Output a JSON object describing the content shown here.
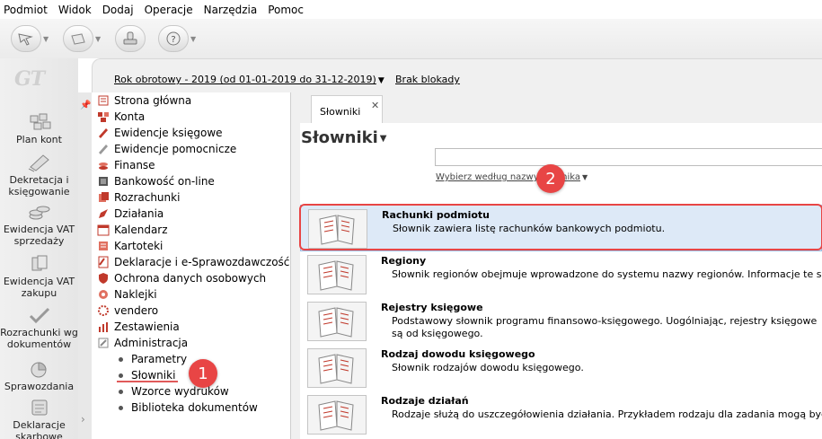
{
  "menu": [
    "Podmiot",
    "Widok",
    "Dodaj",
    "Operacje",
    "Narzędzia",
    "Pomoc"
  ],
  "logo": "GT",
  "left_panel": {
    "items": [
      {
        "label": "Plan kont",
        "icon": "plan-kont-icon"
      },
      {
        "label": "Dekretacja i księgowanie",
        "icon": "dekretacja-icon"
      },
      {
        "label": "Ewidencja VAT sprzedaży",
        "icon": "vat-sprzedazy-icon"
      },
      {
        "label": "Ewidencja VAT zakupu",
        "icon": "vat-zakupu-icon"
      },
      {
        "label": "Rozrachunki wg dokumentów",
        "icon": "rozrachunki-icon"
      },
      {
        "label": "Sprawozdania",
        "icon": "sprawozdania-icon"
      },
      {
        "label": "Deklaracje skarbowe",
        "icon": "deklaracje-icon"
      }
    ]
  },
  "pathbar": {
    "rok": "Rok obrotowy - 2019  (od 01-01-2019 do 31-12-2019)",
    "blokada": "Brak blokady"
  },
  "tree": {
    "items": [
      {
        "label": "Strona główna",
        "icon": "home-icon",
        "color": "#c0392b"
      },
      {
        "label": "Konta",
        "icon": "accounts-icon",
        "color": "#c0392b"
      },
      {
        "label": "Ewidencje księgowe",
        "icon": "ledger-icon",
        "color": "#c0392b"
      },
      {
        "label": "Ewidencje pomocnicze",
        "icon": "aux-ledger-icon",
        "color": "#888888"
      },
      {
        "label": "Finanse",
        "icon": "finance-icon",
        "color": "#c0392b"
      },
      {
        "label": "Bankowość on-line",
        "icon": "bank-icon",
        "color": "#555555"
      },
      {
        "label": "Rozrachunki",
        "icon": "settlements-icon",
        "color": "#c0392b"
      },
      {
        "label": "Działania",
        "icon": "actions-icon",
        "color": "#c0392b"
      },
      {
        "label": "Kalendarz",
        "icon": "calendar-icon",
        "color": "#c0392b"
      },
      {
        "label": "Kartoteki",
        "icon": "files-icon",
        "color": "#c0392b"
      },
      {
        "label": "Deklaracje i e-Sprawozdawczość",
        "icon": "declarations-icon",
        "color": "#c0392b"
      },
      {
        "label": "Ochrona danych osobowych",
        "icon": "shield-icon",
        "color": "#c0392b"
      },
      {
        "label": "Naklejki",
        "icon": "stickers-icon",
        "color": "#c0392b"
      },
      {
        "label": "vendero",
        "icon": "vendero-icon",
        "color": "#c0392b"
      },
      {
        "label": "Zestawienia",
        "icon": "reports-icon",
        "color": "#c0392b"
      },
      {
        "label": "Administracja",
        "icon": "admin-icon",
        "color": "#888888"
      }
    ],
    "sub_items": [
      "Parametry",
      "Słowniki",
      "Wzorce wydruków",
      "Biblioteka dokumentów"
    ]
  },
  "tab": {
    "label": "Słowniki",
    "close": "✕"
  },
  "content": {
    "heading": "Słowniki",
    "search_mode": "Wybierz według nazwy słownika",
    "dictionaries": [
      {
        "title": "Rachunki podmiotu",
        "desc": "Słownik zawiera listę rachunków bankowych podmiotu."
      },
      {
        "title": "Regiony",
        "desc": "Słownik regionów obejmuje wprowadzone do systemu nazwy regionów. Informacje te są wyk"
      },
      {
        "title": "Rejestry księgowe",
        "desc": "Podstawowy słownik programu finansowo-księgowego. Uogólniając, rejestry księgowe są od księgowego."
      },
      {
        "title": "Rodzaj dowodu księgowego",
        "desc": "Słownik rodzajów dowodu księgowego."
      },
      {
        "title": "Rodzaje działań",
        "desc": "Rodzaje służą do uszczegółowienia działania. Przykładem rodzaju dla zadania mogą być: \"Zad"
      }
    ]
  },
  "badges": [
    "1",
    "2"
  ],
  "colors": {
    "accent_red": "#e84545",
    "selection": "#dde9f7"
  }
}
